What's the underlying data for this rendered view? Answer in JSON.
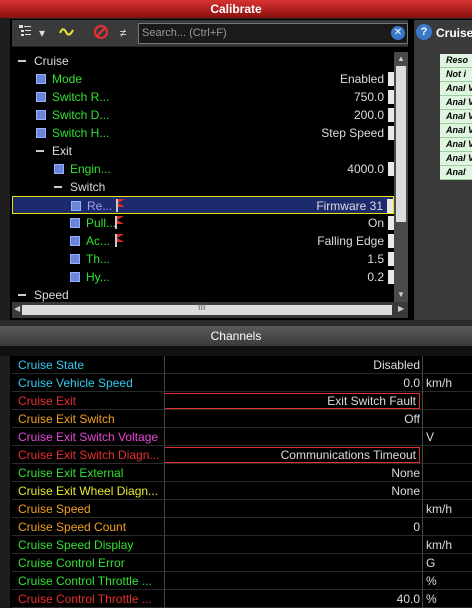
{
  "calibrate": {
    "title": "Calibrate",
    "search_placeholder": "Search... (Ctrl+F)",
    "tree": [
      {
        "kind": "cat",
        "level": 0,
        "label": "Cruise"
      },
      {
        "kind": "item",
        "level": 1,
        "label": "Mode",
        "value": "Enabled",
        "color": "#33e033"
      },
      {
        "kind": "item",
        "level": 1,
        "label": "Switch R...",
        "value": "750.0",
        "color": "#33e033"
      },
      {
        "kind": "item",
        "level": 1,
        "label": "Switch D...",
        "value": "200.0",
        "color": "#33e033"
      },
      {
        "kind": "item",
        "level": 1,
        "label": "Switch H...",
        "value": "Step Speed",
        "color": "#33e033"
      },
      {
        "kind": "cat",
        "level": 1,
        "label": "Exit"
      },
      {
        "kind": "item",
        "level": 2,
        "label": "Engin...",
        "value": "4000.0",
        "color": "#33e033"
      },
      {
        "kind": "cat",
        "level": 2,
        "label": "Switch"
      },
      {
        "kind": "item",
        "level": 3,
        "label": "Re...",
        "value": "Firmware 31",
        "color": "#a79df0",
        "flag": true,
        "selected": true
      },
      {
        "kind": "item",
        "level": 3,
        "label": "Pull...",
        "value": "On",
        "color": "#33e033",
        "flag": true
      },
      {
        "kind": "item",
        "level": 3,
        "label": "Ac...",
        "value": "Falling Edge",
        "color": "#33e033",
        "flag": true
      },
      {
        "kind": "item",
        "level": 3,
        "label": "Th...",
        "value": "1.5",
        "color": "#33e033"
      },
      {
        "kind": "item",
        "level": 3,
        "label": "Hy...",
        "value": "0.2",
        "color": "#33e033"
      },
      {
        "kind": "cat",
        "level": 0,
        "label": "Speed"
      }
    ],
    "hscroll_label": "III"
  },
  "right_panel": {
    "title": "Cruise",
    "cells": [
      "Reso",
      "Not i",
      "Anal Volta Inpu",
      "Anal Volta Inpu",
      "Anal Volta Inpu",
      "Anal Volta Inpu",
      "Anal Volta Inpu",
      "Anal Volta Inpu",
      "Anal"
    ]
  },
  "channels": {
    "title": "Channels",
    "rows": [
      {
        "label": "Cruise State",
        "value": "Disabled",
        "unit": "",
        "color": "#33c8f0",
        "boxed": false
      },
      {
        "label": "Cruise Vehicle Speed",
        "value": "0.0",
        "unit": "km/h",
        "color": "#33c8f0",
        "boxed": false
      },
      {
        "label": "Cruise Exit",
        "value": "Exit Switch Fault",
        "unit": "",
        "color": "#e83030",
        "boxed": true
      },
      {
        "label": "Cruise Exit Switch",
        "value": "Off",
        "unit": "",
        "color": "#f0a020",
        "boxed": false
      },
      {
        "label": "Cruise Exit Switch Voltage",
        "value": "",
        "unit": "V",
        "color": "#e848d8",
        "boxed": false
      },
      {
        "label": "Cruise Exit Switch Diagn...",
        "value": "Communications Timeout",
        "unit": "",
        "color": "#e83030",
        "boxed": true
      },
      {
        "label": "Cruise Exit External",
        "value": "None",
        "unit": "",
        "color": "#33e033",
        "boxed": false
      },
      {
        "label": "Cruise Exit Wheel Diagn...",
        "value": "None",
        "unit": "",
        "color": "#e8e830",
        "boxed": false
      },
      {
        "label": "Cruise Speed",
        "value": "",
        "unit": "km/h",
        "color": "#f0a020",
        "boxed": false
      },
      {
        "label": "Cruise Speed Count",
        "value": "0",
        "unit": "",
        "color": "#f0a020",
        "boxed": false
      },
      {
        "label": "Cruise Speed Display",
        "value": "",
        "unit": "km/h",
        "color": "#33e033",
        "boxed": false
      },
      {
        "label": "Cruise Control Error",
        "value": "",
        "unit": "G",
        "color": "#33e033",
        "boxed": false
      },
      {
        "label": "Cruise Control Throttle ...",
        "value": "",
        "unit": "%",
        "color": "#33e033",
        "boxed": false
      },
      {
        "label": "Cruise Control Throttle ...",
        "value": "40.0",
        "unit": "%",
        "color": "#e83030",
        "boxed": false
      }
    ]
  }
}
